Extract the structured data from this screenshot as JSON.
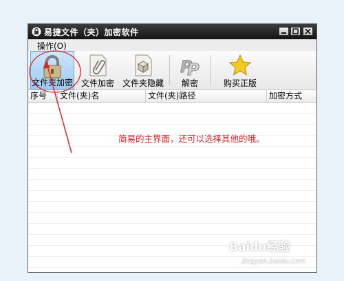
{
  "window": {
    "title": "易捷文件（夹）加密软件"
  },
  "menu": {
    "items": [
      {
        "label": "操作(O)"
      }
    ]
  },
  "toolbar": {
    "buttons": [
      {
        "label": "文件夹加密",
        "icon": "lock-icon",
        "active": true
      },
      {
        "label": "文件加密",
        "icon": "paperclip-document-icon"
      },
      {
        "label": "文件夹隐藏",
        "icon": "box-document-icon"
      },
      {
        "label": "解密",
        "icon": "pp-decrypt-icon"
      },
      {
        "label": "购买正版",
        "icon": "star-icon"
      }
    ]
  },
  "table": {
    "columns": [
      "序号",
      "文件(夹)名",
      "文件(夹)路径",
      "加密方式"
    ],
    "rows": []
  },
  "annotation": {
    "text": "简易的主界面，还可以选择其他的哦。",
    "color": "#d8232a"
  },
  "watermark": {
    "brand": "Baidu经验",
    "url": "jingyan.baidu.com"
  }
}
